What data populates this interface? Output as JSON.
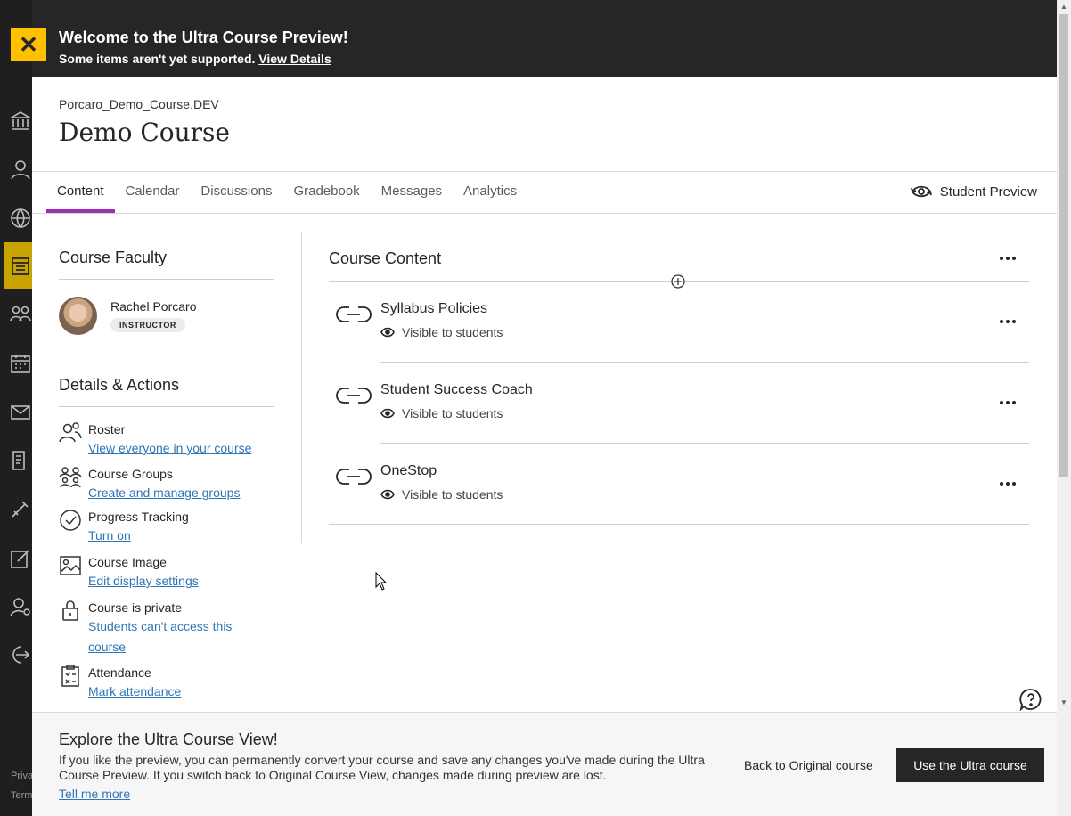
{
  "banner": {
    "title": "Welcome to the Ultra Course Preview!",
    "subtitle": "Some items aren't yet supported.",
    "details_link": "View Details"
  },
  "header": {
    "course_id": "Porcaro_Demo_Course.DEV",
    "course_title": "Demo Course"
  },
  "tabs": [
    {
      "label": "Content",
      "active": true
    },
    {
      "label": "Calendar"
    },
    {
      "label": "Discussions"
    },
    {
      "label": "Gradebook"
    },
    {
      "label": "Messages"
    },
    {
      "label": "Analytics"
    }
  ],
  "student_preview": "Student Preview",
  "faculty": {
    "title": "Course Faculty",
    "name": "Rachel Porcaro",
    "role": "INSTRUCTOR"
  },
  "details": {
    "title": "Details & Actions",
    "items": [
      {
        "label": "Roster",
        "link": "View everyone in your course",
        "icon": "roster-icon"
      },
      {
        "label": "Course Groups",
        "link": "Create and manage groups",
        "icon": "groups-icon"
      },
      {
        "label": "Progress Tracking",
        "link": "Turn on",
        "icon": "checkmark-circle-icon"
      },
      {
        "label": "Course Image",
        "link": "Edit display settings",
        "icon": "image-icon"
      },
      {
        "label": "Course is private",
        "link": "Students can't access this course",
        "icon": "lock-icon"
      },
      {
        "label": "Attendance",
        "link": "Mark attendance",
        "icon": "clipboard-icon"
      }
    ]
  },
  "content": {
    "title": "Course Content",
    "items": [
      {
        "name": "Syllabus Policies",
        "visibility": "Visible to students"
      },
      {
        "name": "Student Success Coach",
        "visibility": "Visible to students"
      },
      {
        "name": "OneStop",
        "visibility": "Visible to students"
      }
    ]
  },
  "bottom": {
    "title": "Explore the Ultra Course View!",
    "text": "If you like the preview, you can permanently convert your course and save any changes you've made during the Ultra Course Preview. If you switch back to Original Course View, changes made during preview are lost.",
    "tell_more": "Tell me more",
    "back_link": "Back to Original course",
    "use_button": "Use the Ultra course"
  },
  "rail_footer": [
    "Priva",
    "Term"
  ],
  "colors": {
    "accent": "#ffc000",
    "tab_active": "#9d2fb5",
    "link": "#2f76b5",
    "banner": "#262626"
  }
}
